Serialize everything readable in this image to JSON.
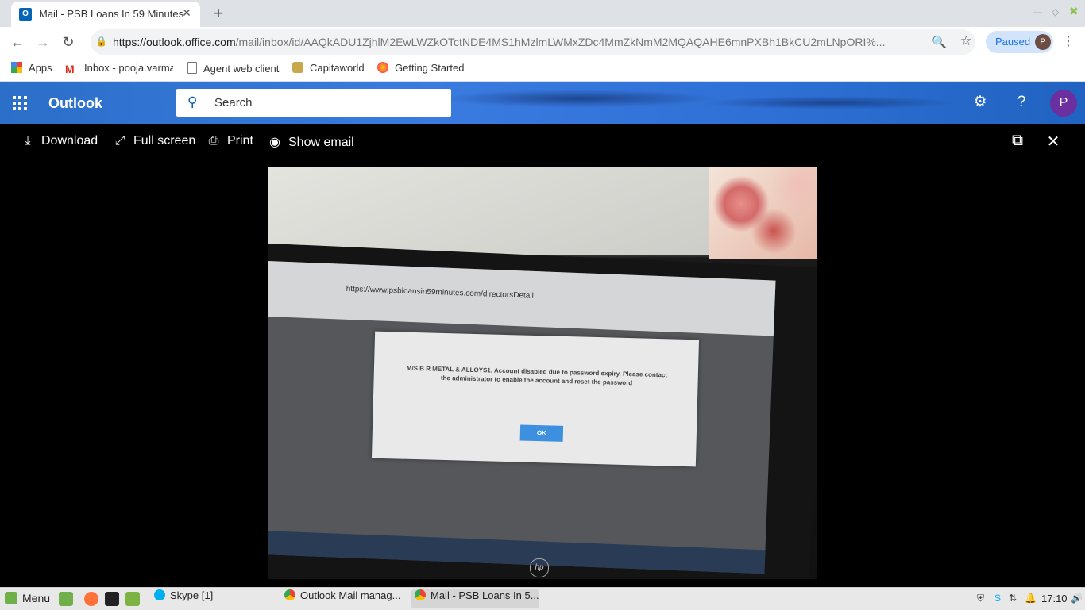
{
  "browser": {
    "tab": {
      "title": "Mail - PSB Loans In 59 Minutes",
      "favicon": "outlook-icon",
      "favicon_text": "O"
    },
    "url_domain": "https://outlook.office.com",
    "url_path": "/mail/inbox/id/AAQkADU1ZjhlM2EwLWZkOTctNDE4MS1hMzlmLWMxZDc4MmZkNmM2MQAQAHE6mnPXBh1BkCU2mLNpORI%...",
    "profile_label": "Paused",
    "profile_initial": "P",
    "bookmarks": [
      {
        "label": "Apps",
        "icon": "apps-grid-icon"
      },
      {
        "label": "Inbox - pooja.varma",
        "icon": "gmail-icon"
      },
      {
        "label": "Agent web client",
        "icon": "page-icon"
      },
      {
        "label": "Capitaworld",
        "icon": "capitaworld-icon"
      },
      {
        "label": "Getting Started",
        "icon": "firefox-icon"
      }
    ]
  },
  "outlook": {
    "brand": "Outlook",
    "search_placeholder": "Search",
    "user_initial": "P"
  },
  "viewer": {
    "actions": [
      {
        "label": "Download",
        "icon": "download-icon"
      },
      {
        "label": "Full screen",
        "icon": "fullscreen-icon"
      },
      {
        "label": "Print",
        "icon": "print-icon"
      },
      {
        "label": "Show email",
        "icon": "eye-icon"
      }
    ]
  },
  "photo": {
    "inner_url": "https://www.psbloansin59minutes.com/directorsDetail",
    "dialog_message": "M/S B R METAL & ALLOYS1. Account disabled due to password expiry. Please contact the administrator to enable the account and reset the password",
    "dialog_button": "OK",
    "monitor_brand": "hp"
  },
  "taskbar": {
    "menu_label": "Menu",
    "tasks": [
      {
        "label": "Skype [1]",
        "icon": "skype-icon"
      },
      {
        "label": "Outlook Mail manag...",
        "icon": "chrome-icon"
      },
      {
        "label": "Mail - PSB Loans In 5...",
        "icon": "chrome-icon"
      }
    ],
    "clock": "17:10"
  }
}
